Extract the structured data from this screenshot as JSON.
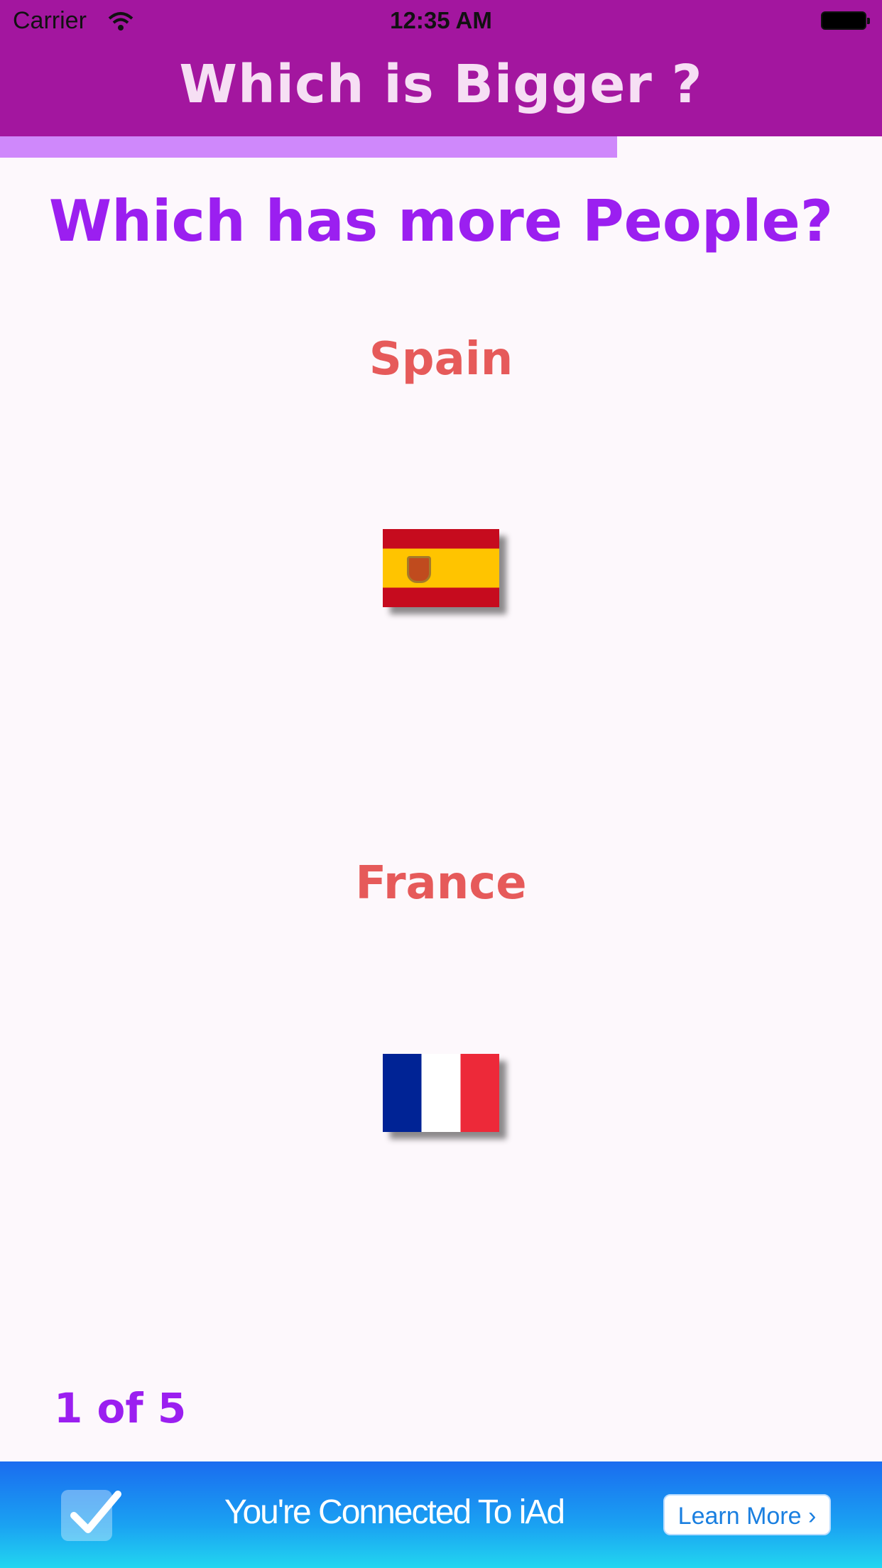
{
  "status_bar": {
    "carrier": "Carrier",
    "time": "12:35 AM"
  },
  "header": {
    "title": "Which is Bigger ?"
  },
  "progress": {
    "value": 0.7
  },
  "quiz": {
    "question": "Which has more People?",
    "options": [
      {
        "name": "Spain",
        "flag": "spain-flag-icon"
      },
      {
        "name": "France",
        "flag": "france-flag-icon"
      }
    ],
    "counter": "1 of 5"
  },
  "ad": {
    "text": "You're Connected To iAd",
    "button_label": "Learn More",
    "button_chevron": "›",
    "icon": "checkmark-icon"
  },
  "colors": {
    "header": "#a3169f",
    "progress": "#cf88fb",
    "question": "#9b1ff0",
    "country": "#e65a5a"
  }
}
